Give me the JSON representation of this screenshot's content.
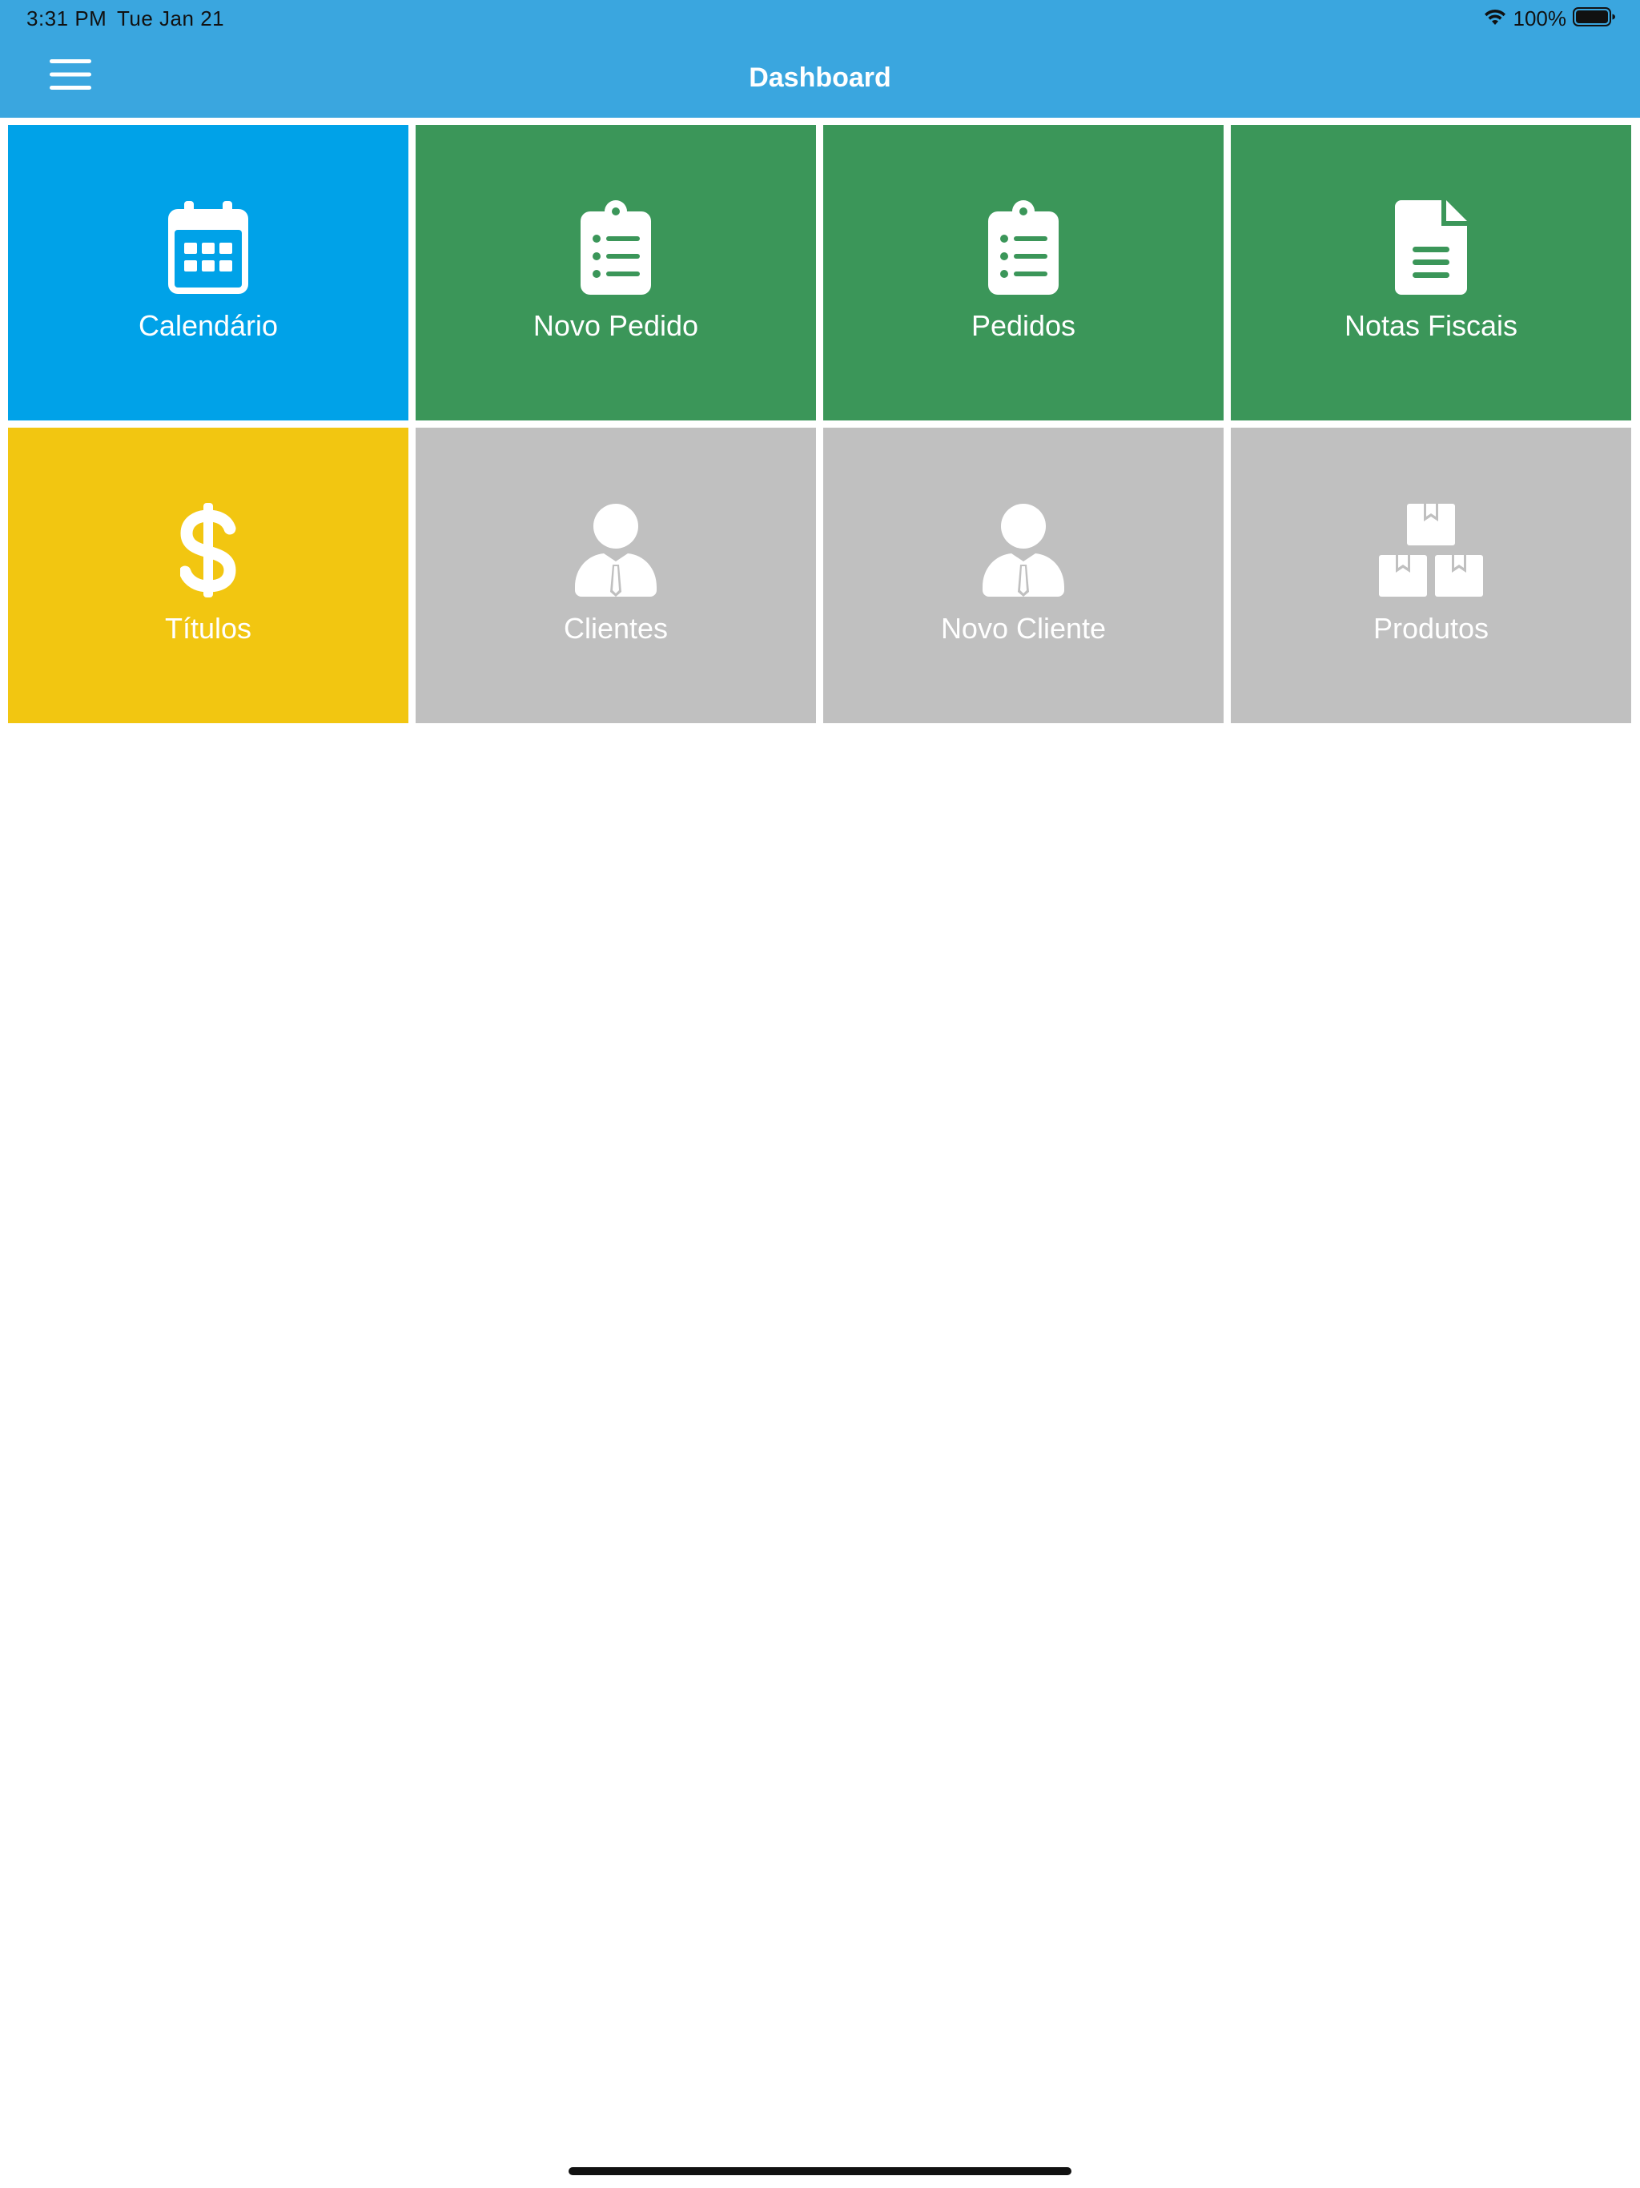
{
  "status_bar": {
    "time": "3:31 PM",
    "date": "Tue Jan 21",
    "battery_percent": "100%",
    "battery_level": 1.0,
    "wifi_icon": "wifi-icon",
    "battery_icon": "battery-icon"
  },
  "nav": {
    "title": "Dashboard",
    "menu_icon": "hamburger-menu-icon"
  },
  "colors": {
    "nav_background": "#3aa6df",
    "calendar_tile": "#00a2e8",
    "order_tiles": "#3b9659",
    "titles_tile": "#f2c611",
    "disabled_tiles": "#c0c0c0",
    "text_on_tile": "#ffffff"
  },
  "tiles": [
    {
      "label": "Calendário",
      "icon": "calendar-icon",
      "color": "#00a2e8"
    },
    {
      "label": "Novo Pedido",
      "icon": "clipboard-list-icon",
      "color": "#3b9659"
    },
    {
      "label": "Pedidos",
      "icon": "clipboard-list-icon",
      "color": "#3b9659"
    },
    {
      "label": "Notas Fiscais",
      "icon": "document-icon",
      "color": "#3b9659"
    },
    {
      "label": "Títulos",
      "icon": "dollar-icon",
      "color": "#f2c611"
    },
    {
      "label": "Clientes",
      "icon": "user-tie-icon",
      "color": "#c0c0c0"
    },
    {
      "label": "Novo Cliente",
      "icon": "user-tie-icon",
      "color": "#c0c0c0"
    },
    {
      "label": "Produtos",
      "icon": "boxes-icon",
      "color": "#c0c0c0"
    }
  ]
}
